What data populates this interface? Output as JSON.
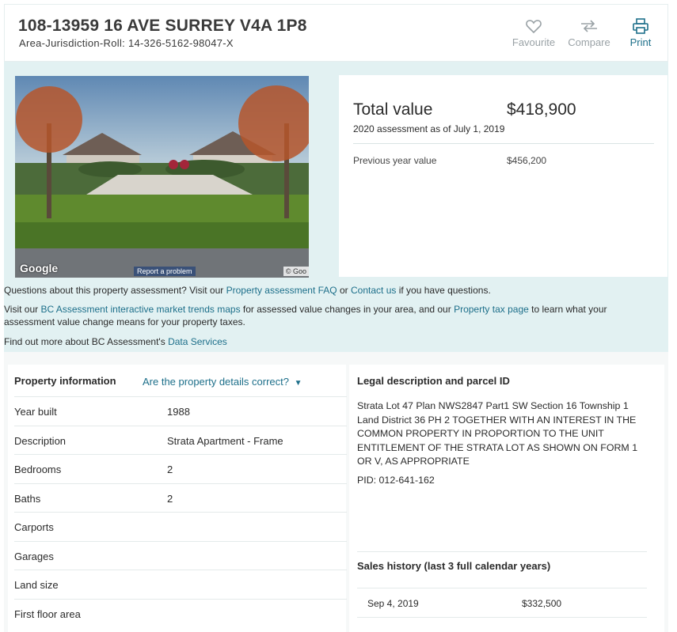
{
  "header": {
    "address": "108-13959 16 AVE SURREY V4A 1P8",
    "roll": "Area-Jurisdiction-Roll: 14-326-5162-98047-X",
    "actions": [
      {
        "label": "Favourite",
        "icon": "heart-icon"
      },
      {
        "label": "Compare",
        "icon": "compare-arrows-icon"
      },
      {
        "label": "Print",
        "icon": "printer-icon"
      }
    ]
  },
  "photo": {
    "google_label": "Google",
    "report_label": "Report a problem",
    "copyright": "© Goo"
  },
  "valuation": {
    "total_label": "Total value",
    "total_amount": "$418,900",
    "as_of": "2020 assessment as of July 1, 2019",
    "previous_label": "Previous year value",
    "previous_amount": "$456,200"
  },
  "info": {
    "line1_pre": "Questions about this property assessment? Visit our ",
    "faq_link": "Property assessment FAQ",
    "line1_mid": " or ",
    "contact_link": "Contact us",
    "line1_post": " if you have questions.",
    "line2_pre": "Visit our ",
    "trends_link": "BC Assessment interactive market trends maps",
    "line2_mid": " for assessed value changes in your area, and our ",
    "tax_link": "Property tax page",
    "line2_post": " to learn what your",
    "line2b": "assessment value change means for your property taxes.",
    "line3_pre": "Find out more about BC Assessment's ",
    "data_link": "Data Services"
  },
  "property": {
    "heading": "Property information",
    "check_link": "Are the property details correct?",
    "rows": [
      {
        "key": "Year built",
        "value": "1988"
      },
      {
        "key": "Description",
        "value": "Strata Apartment - Frame"
      },
      {
        "key": "Bedrooms",
        "value": "2"
      },
      {
        "key": "Baths",
        "value": "2"
      },
      {
        "key": "Carports",
        "value": ""
      },
      {
        "key": "Garages",
        "value": ""
      },
      {
        "key": "Land size",
        "value": ""
      },
      {
        "key": "First floor area",
        "value": ""
      }
    ]
  },
  "legal": {
    "heading": "Legal description and parcel ID",
    "text": "Strata Lot 47 Plan NWS2847 Part1 SW Section 16 Township 1 Land District 36 PH 2 TOGETHER WITH AN INTEREST IN THE COMMON PROPERTY IN PROPORTION TO THE UNIT ENTITLEMENT OF THE STRATA LOT AS SHOWN ON FORM 1 OR V, AS APPROPRIATE",
    "pid": "PID: 012-641-162",
    "sales_heading": "Sales history (last 3 full calendar years)",
    "sales": [
      {
        "date": "Sep 4, 2019",
        "price": "$332,500"
      }
    ]
  }
}
